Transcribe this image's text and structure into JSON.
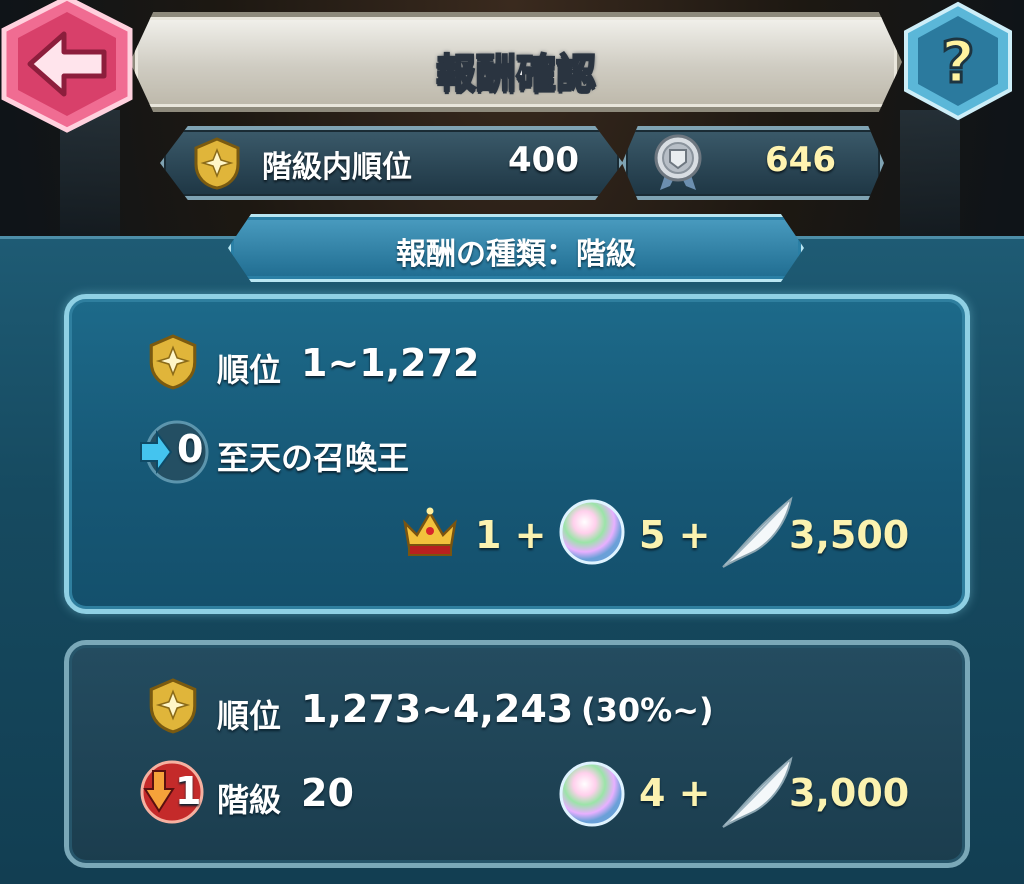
{
  "header": {
    "title": "報酬確認",
    "back_icon": "back-arrow-icon",
    "help_icon": "help-question-icon"
  },
  "stats": {
    "rank_label": "階級内順位",
    "rank_value": "400",
    "score_value": "646"
  },
  "reward_type": {
    "label": "報酬の種類：階級"
  },
  "rewards": [
    {
      "range_label": "順位",
      "range_value": "1~1,272",
      "tier_badge": "0",
      "tier_text": "至天の召喚王",
      "items": [
        {
          "icon": "crown-icon",
          "amount": "1 +"
        },
        {
          "icon": "orb-icon",
          "amount": "5 +"
        },
        {
          "icon": "feather-icon",
          "amount": "3,500"
        }
      ]
    },
    {
      "range_label": "順位",
      "range_value": "1,273~4,243",
      "range_note": "(30%~)",
      "tier_badge": "1",
      "tier_label": "階級",
      "tier_value": "20",
      "items": [
        {
          "icon": "orb-icon",
          "amount": "4 +"
        },
        {
          "icon": "feather-icon",
          "amount": "3,000"
        }
      ]
    }
  ],
  "colors": {
    "accent_gold": "#fbf2b0",
    "panel_blue": "#1d6a8a",
    "back_button": "#e2557a",
    "help_button": "#2f7fa5"
  }
}
